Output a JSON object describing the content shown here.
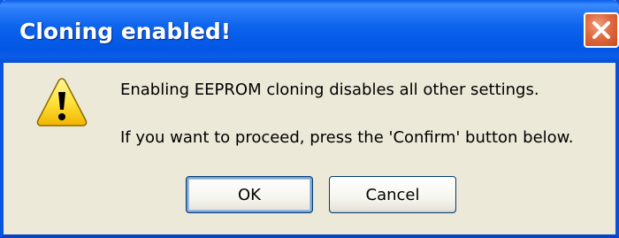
{
  "dialog": {
    "title": "Cloning enabled!",
    "message_line1": "Enabling EEPROM cloning disables all other settings.",
    "message_line2": "If you want to proceed, press the 'Confirm' button below.",
    "buttons": {
      "ok": "OK",
      "cancel": "Cancel"
    },
    "icons": {
      "close": "close-icon",
      "warning": "warning-icon"
    }
  }
}
